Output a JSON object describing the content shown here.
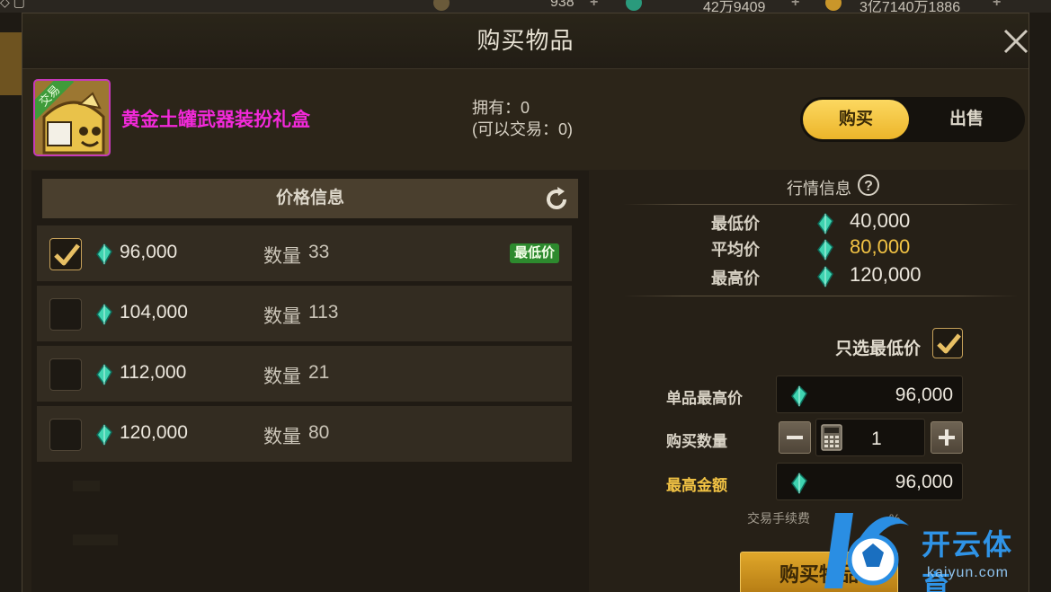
{
  "hud": {
    "value_1": "938",
    "value_2": "42万9409",
    "value_3": "3亿7140万1886"
  },
  "dialog": {
    "title": "购买物品"
  },
  "item": {
    "trade_tag": "交易",
    "name": "黄金土罐武器装扮礼盒",
    "owned": "拥有：0",
    "tradeable": "(可以交易：0)"
  },
  "mode_toggle": {
    "buy": "购买",
    "sell": "出售",
    "active": "buy"
  },
  "listing": {
    "header": "价格信息",
    "rows": [
      {
        "price": "96,000",
        "qty_label": "数量",
        "qty": "33",
        "checked": true,
        "badge": "最低价"
      },
      {
        "price": "104,000",
        "qty_label": "数量",
        "qty": "113",
        "checked": false,
        "badge": ""
      },
      {
        "price": "112,000",
        "qty_label": "数量",
        "qty": "21",
        "checked": false,
        "badge": ""
      },
      {
        "price": "120,000",
        "qty_label": "数量",
        "qty": "80",
        "checked": false,
        "badge": ""
      }
    ]
  },
  "market": {
    "title": "行情信息",
    "lowest_label": "最低价",
    "lowest_value": "40,000",
    "average_label": "平均价",
    "average_value": "80,000",
    "highest_label": "最高价",
    "highest_value": "120,000"
  },
  "purchase_form": {
    "only_lowest_label": "只选最低价",
    "only_lowest_checked": true,
    "max_unit_price_label": "单品最高价",
    "max_unit_price": "96,000",
    "quantity_label": "购买数量",
    "quantity": "1",
    "max_total_label": "最高金额",
    "max_total": "96,000",
    "fee_note": "交易手续费",
    "fee_tail": "%",
    "submit": "购买物品"
  },
  "watermark": {
    "text": "开云体育",
    "url": "kaiyun.com"
  },
  "colors": {
    "gold_accent": "#f2c344",
    "item_name": "#f229d9",
    "lowest_badge": "#2d8a2e",
    "gem": "#3fd3b0"
  }
}
